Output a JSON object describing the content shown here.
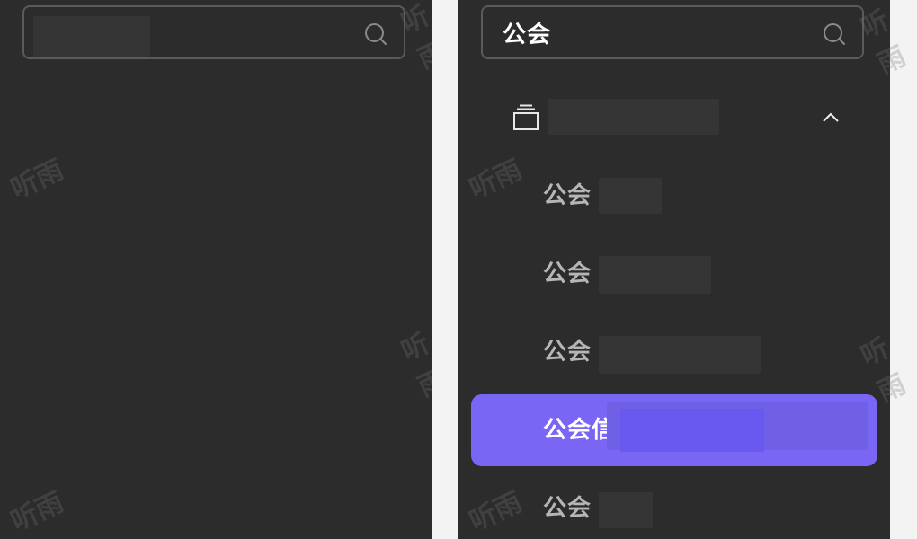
{
  "left_panel": {
    "search": {
      "value": ""
    }
  },
  "right_panel": {
    "search": {
      "value": "公会"
    },
    "tree": {
      "items": [
        {
          "label": "公会",
          "active": false
        },
        {
          "label": "公会",
          "active": false
        },
        {
          "label": "公会",
          "active": false
        },
        {
          "label": "公会信",
          "active": true
        },
        {
          "label": "公会",
          "active": false
        }
      ]
    }
  },
  "watermark": {
    "text": "听雨"
  },
  "colors": {
    "panel_bg": "#2c2c2c",
    "page_bg": "#f3f3f3",
    "accent": "#7a66f4",
    "item_text": "#b6b6b6",
    "border": "#5a5a5a"
  }
}
